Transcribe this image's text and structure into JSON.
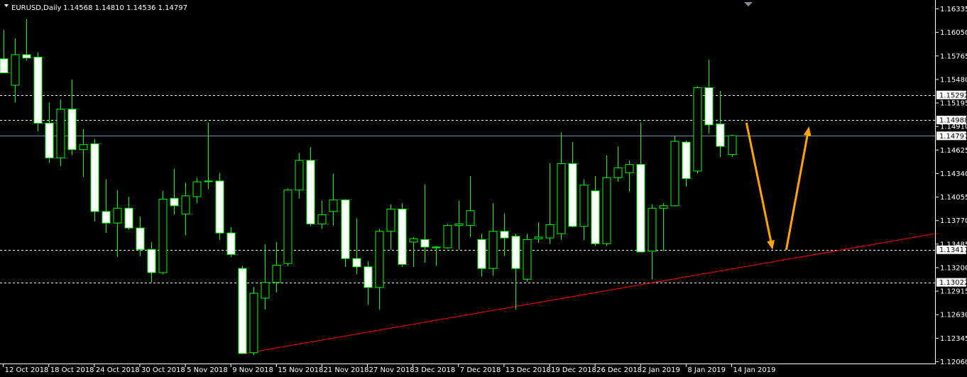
{
  "header": {
    "symbol": "EURUSD,Daily",
    "ohlc": "1.14568 1.14810 1.14536 1.14797"
  },
  "colors": {
    "background": "#000000",
    "axis": "#ffffff",
    "bull_body": "#000000",
    "bull_outline": "#00ff00",
    "bear_body": "#ffffff",
    "bear_outline": "#00ff00",
    "wick": "#00ff00",
    "level_line": "#ffffff",
    "current_price_line": "#6f8aa8",
    "trendline": "#ff0000",
    "arrow": "#ffa500"
  },
  "chart_data": {
    "type": "candlestick",
    "symbol": "EURUSD",
    "timeframe": "Daily",
    "y_range": [
      1.1206,
      1.16335
    ],
    "y_ticks": [
      "1.16335",
      "1.16050",
      "1.15765",
      "1.15480",
      "1.15195",
      "1.14910",
      "1.14625",
      "1.14340",
      "1.14055",
      "1.13770",
      "1.13485",
      "1.13200",
      "1.12915",
      "1.12630",
      "1.12345",
      "1.12060"
    ],
    "x_labels": [
      "12 Oct 2018",
      "18 Oct 2018",
      "24 Oct 2018",
      "30 Oct 2018",
      "5 Nov 2018",
      "9 Nov 2018",
      "15 Nov 2018",
      "21 Nov 2018",
      "27 Nov 2018",
      "3 Dec 2018",
      "7 Dec 2018",
      "13 Dec 2018",
      "19 Dec 2018",
      "26 Dec 2018",
      "2 Jan 2019",
      "8 Jan 2019",
      "14 Jan 2019"
    ],
    "x_label_bar_index": [
      0,
      4,
      8,
      12,
      16,
      20,
      24,
      28,
      32,
      36,
      40,
      44,
      48,
      52,
      56,
      60,
      64
    ],
    "candles": [
      {
        "o": 1.1573,
        "h": 1.1608,
        "l": 1.1557,
        "c": 1.1556
      },
      {
        "o": 1.1541,
        "h": 1.1598,
        "l": 1.152,
        "c": 1.1578
      },
      {
        "o": 1.1578,
        "h": 1.1621,
        "l": 1.1571,
        "c": 1.1574
      },
      {
        "o": 1.1575,
        "h": 1.1581,
        "l": 1.1485,
        "c": 1.1495
      },
      {
        "o": 1.1495,
        "h": 1.152,
        "l": 1.1447,
        "c": 1.1453
      },
      {
        "o": 1.1453,
        "h": 1.1524,
        "l": 1.1443,
        "c": 1.1512
      },
      {
        "o": 1.1512,
        "h": 1.1548,
        "l": 1.1456,
        "c": 1.1463
      },
      {
        "o": 1.1463,
        "h": 1.1488,
        "l": 1.143,
        "c": 1.1469
      },
      {
        "o": 1.147,
        "h": 1.1476,
        "l": 1.1376,
        "c": 1.1388
      },
      {
        "o": 1.1388,
        "h": 1.1427,
        "l": 1.1362,
        "c": 1.1374
      },
      {
        "o": 1.1374,
        "h": 1.1414,
        "l": 1.1333,
        "c": 1.1392
      },
      {
        "o": 1.1392,
        "h": 1.1406,
        "l": 1.1366,
        "c": 1.1368
      },
      {
        "o": 1.1368,
        "h": 1.1382,
        "l": 1.1334,
        "c": 1.1342
      },
      {
        "o": 1.1342,
        "h": 1.1351,
        "l": 1.1302,
        "c": 1.1314
      },
      {
        "o": 1.1314,
        "h": 1.1413,
        "l": 1.1312,
        "c": 1.1403
      },
      {
        "o": 1.1404,
        "h": 1.144,
        "l": 1.1384,
        "c": 1.1395
      },
      {
        "o": 1.1385,
        "h": 1.1423,
        "l": 1.1359,
        "c": 1.1407
      },
      {
        "o": 1.1406,
        "h": 1.1429,
        "l": 1.1398,
        "c": 1.1424
      },
      {
        "o": 1.1425,
        "h": 1.1496,
        "l": 1.1415,
        "c": 1.1425
      },
      {
        "o": 1.1425,
        "h": 1.1435,
        "l": 1.1354,
        "c": 1.1362
      },
      {
        "o": 1.1362,
        "h": 1.1369,
        "l": 1.1333,
        "c": 1.1336
      },
      {
        "o": 1.1319,
        "h": 1.1322,
        "l": 1.1216,
        "c": 1.1216
      },
      {
        "o": 1.1217,
        "h": 1.1297,
        "l": 1.1214,
        "c": 1.1289
      },
      {
        "o": 1.1283,
        "h": 1.1348,
        "l": 1.1269,
        "c": 1.1302
      },
      {
        "o": 1.1302,
        "h": 1.1351,
        "l": 1.129,
        "c": 1.1323
      },
      {
        "o": 1.1325,
        "h": 1.1416,
        "l": 1.1322,
        "c": 1.1414
      },
      {
        "o": 1.1414,
        "h": 1.1459,
        "l": 1.1404,
        "c": 1.145
      },
      {
        "o": 1.145,
        "h": 1.1466,
        "l": 1.1371,
        "c": 1.1373
      },
      {
        "o": 1.1373,
        "h": 1.1401,
        "l": 1.1367,
        "c": 1.1384
      },
      {
        "o": 1.1388,
        "h": 1.1434,
        "l": 1.1371,
        "c": 1.1402
      },
      {
        "o": 1.1402,
        "h": 1.1403,
        "l": 1.1321,
        "c": 1.1331
      },
      {
        "o": 1.1331,
        "h": 1.138,
        "l": 1.1312,
        "c": 1.1321
      },
      {
        "o": 1.1321,
        "h": 1.1328,
        "l": 1.1275,
        "c": 1.1296
      },
      {
        "o": 1.1296,
        "h": 1.1367,
        "l": 1.1269,
        "c": 1.1364
      },
      {
        "o": 1.1364,
        "h": 1.1397,
        "l": 1.1342,
        "c": 1.1391
      },
      {
        "o": 1.1391,
        "h": 1.1398,
        "l": 1.1321,
        "c": 1.1324
      },
      {
        "o": 1.1351,
        "h": 1.1357,
        "l": 1.1321,
        "c": 1.1355
      },
      {
        "o": 1.1354,
        "h": 1.1421,
        "l": 1.1326,
        "c": 1.1345
      },
      {
        "o": 1.1344,
        "h": 1.1346,
        "l": 1.1322,
        "c": 1.1345
      },
      {
        "o": 1.1344,
        "h": 1.1373,
        "l": 1.1343,
        "c": 1.1371
      },
      {
        "o": 1.1371,
        "h": 1.1401,
        "l": 1.1342,
        "c": 1.1373
      },
      {
        "o": 1.1371,
        "h": 1.1431,
        "l": 1.1357,
        "c": 1.1389
      },
      {
        "o": 1.1354,
        "h": 1.1361,
        "l": 1.1309,
        "c": 1.1319
      },
      {
        "o": 1.1319,
        "h": 1.1398,
        "l": 1.131,
        "c": 1.1364
      },
      {
        "o": 1.1364,
        "h": 1.1386,
        "l": 1.1334,
        "c": 1.1356
      },
      {
        "o": 1.1358,
        "h": 1.1361,
        "l": 1.1269,
        "c": 1.1319
      },
      {
        "o": 1.1306,
        "h": 1.1361,
        "l": 1.1303,
        "c": 1.1354
      },
      {
        "o": 1.1355,
        "h": 1.1375,
        "l": 1.135,
        "c": 1.1357
      },
      {
        "o": 1.1356,
        "h": 1.1447,
        "l": 1.1349,
        "c": 1.1372
      },
      {
        "o": 1.1361,
        "h": 1.1484,
        "l": 1.1354,
        "c": 1.1446
      },
      {
        "o": 1.1446,
        "h": 1.1472,
        "l": 1.1369,
        "c": 1.137
      },
      {
        "o": 1.137,
        "h": 1.1427,
        "l": 1.1353,
        "c": 1.142
      },
      {
        "o": 1.1413,
        "h": 1.1431,
        "l": 1.1346,
        "c": 1.1349
      },
      {
        "o": 1.1349,
        "h": 1.1456,
        "l": 1.1346,
        "c": 1.1429
      },
      {
        "o": 1.1429,
        "h": 1.1467,
        "l": 1.1424,
        "c": 1.1441
      },
      {
        "o": 1.1435,
        "h": 1.145,
        "l": 1.1412,
        "c": 1.1445
      },
      {
        "o": 1.1445,
        "h": 1.1496,
        "l": 1.1339,
        "c": 1.1339
      },
      {
        "o": 1.134,
        "h": 1.1397,
        "l": 1.1306,
        "c": 1.1392
      },
      {
        "o": 1.1392,
        "h": 1.1398,
        "l": 1.134,
        "c": 1.1395
      },
      {
        "o": 1.1395,
        "h": 1.148,
        "l": 1.1394,
        "c": 1.1473
      },
      {
        "o": 1.1472,
        "h": 1.1474,
        "l": 1.1418,
        "c": 1.1428
      },
      {
        "o": 1.1437,
        "h": 1.154,
        "l": 1.1434,
        "c": 1.1538
      },
      {
        "o": 1.1538,
        "h": 1.1572,
        "l": 1.1482,
        "c": 1.1493
      },
      {
        "o": 1.1494,
        "h": 1.1534,
        "l": 1.1454,
        "c": 1.1467
      },
      {
        "o": 1.1457,
        "h": 1.1481,
        "l": 1.1454,
        "c": 1.148
      }
    ],
    "levels": [
      {
        "price": 1.15292,
        "label": "1.15292",
        "style": "dashed"
      },
      {
        "price": 1.14988,
        "label": "1.14988",
        "style": "dashed"
      },
      {
        "price": 1.13417,
        "label": "1.13417",
        "style": "dashed"
      },
      {
        "price": 1.13022,
        "label": "1.13022",
        "style": "dashed"
      }
    ],
    "current_price": {
      "price": 1.14797,
      "label": "1.14797"
    },
    "trendline": {
      "from": {
        "bar": 21,
        "price": 1.12155
      },
      "to": {
        "bar": 82.1,
        "price": 1.13617
      }
    },
    "arrows": [
      {
        "from": {
          "bar": 65.3,
          "price": 1.14955
        },
        "to": {
          "bar": 67.6,
          "price": 1.13417
        }
      },
      {
        "from": {
          "bar": 68.8,
          "price": 1.13417
        },
        "to": {
          "bar": 70.8,
          "price": 1.1491
        }
      }
    ]
  }
}
